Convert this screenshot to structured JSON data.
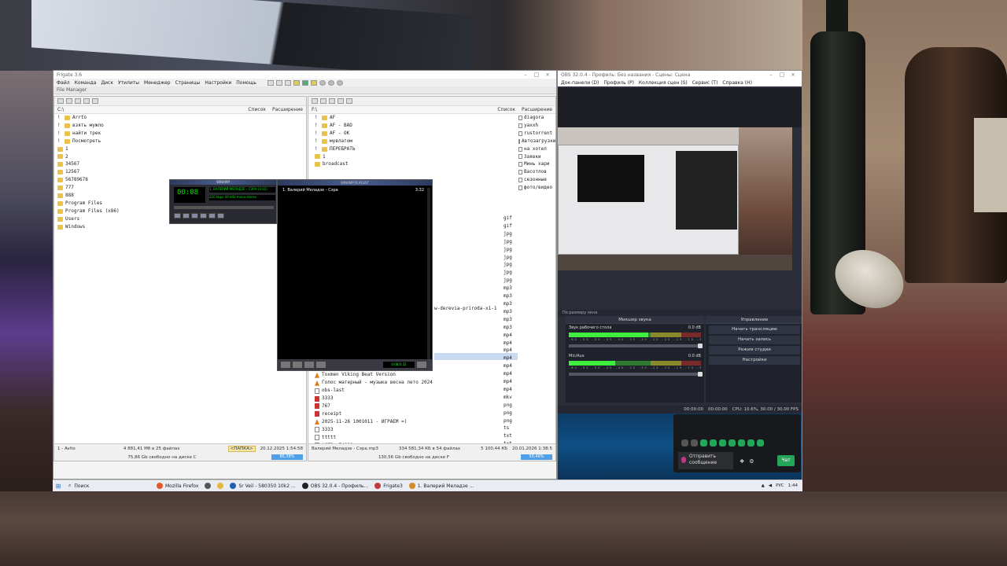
{
  "file_manager": {
    "title": "Frigate 3.6",
    "subtitle": "File Manager",
    "menu": [
      "Файл",
      "Команда",
      "Диск",
      "Утилиты",
      "Менеджер",
      "Страницы",
      "Настройки",
      "Помощь"
    ],
    "left": {
      "path": "C:\\",
      "col_list": "Список",
      "col_ext": "Расширение",
      "items": [
        {
          "name": "Arrto",
          "type": "folder",
          "indent": 1
        },
        {
          "name": "взять мужло",
          "type": "folder",
          "indent": 1
        },
        {
          "name": "найти трек",
          "type": "folder",
          "indent": 1
        },
        {
          "name": "Посмотреть",
          "type": "folder",
          "indent": 1
        },
        {
          "name": "1",
          "type": "folder",
          "indent": 0
        },
        {
          "name": "2",
          "type": "folder",
          "indent": 0
        },
        {
          "name": "34567",
          "type": "folder",
          "indent": 0
        },
        {
          "name": "12567",
          "type": "folder",
          "indent": 0
        },
        {
          "name": "56789678",
          "type": "folder",
          "indent": 0
        },
        {
          "name": "777",
          "type": "folder",
          "indent": 0
        },
        {
          "name": "888",
          "type": "folder",
          "indent": 0
        },
        {
          "name": "Program Files",
          "type": "folder",
          "indent": 0
        },
        {
          "name": "Program Files (x86)",
          "type": "folder",
          "indent": 0
        },
        {
          "name": "Users",
          "type": "folder",
          "indent": 0
        },
        {
          "name": "Windows",
          "type": "folder",
          "indent": 0
        }
      ],
      "status_left": "1 - Avito",
      "status_mid": "4 881,41 Мб в 25 файлах",
      "status_tag": "<ПАПКА>",
      "status_date": "20.12.2025 1:54:58",
      "free_text": "75,86 Gb свободно на диске C",
      "free_pct": "86,38%"
    },
    "right": {
      "path": "F:\\",
      "col_list": "Список",
      "col_ext": "Расширение",
      "items": [
        {
          "name": "AF",
          "type": "folder",
          "indent": 1
        },
        {
          "name": "AF - BAD",
          "type": "folder",
          "indent": 1
        },
        {
          "name": "AF - OK",
          "type": "folder",
          "indent": 1
        },
        {
          "name": "мувлатом",
          "type": "folder",
          "indent": 1
        },
        {
          "name": "ПЕРЕБРАТЬ",
          "type": "folder",
          "indent": 1
        },
        {
          "name": "1",
          "type": "folder",
          "indent": 0
        },
        {
          "name": "broadcast",
          "type": "folder",
          "indent": 0
        }
      ],
      "long_name": "w-derevia-priroda-x1-1",
      "files": [
        {
          "name": "Toxmen Viking Beat Version",
          "icon": "cone"
        },
        {
          "name": "Голос матерный - музыка весна лето 2024",
          "icon": "cone"
        },
        {
          "name": "obs-last",
          "icon": "txt"
        },
        {
          "name": "3333",
          "icon": "img"
        },
        {
          "name": "767",
          "icon": "img"
        },
        {
          "name": "receipt",
          "icon": "img"
        },
        {
          "name": "2025-11-26 1001011 - ИГРАЕМ =)",
          "icon": "cone"
        },
        {
          "name": "3333",
          "icon": "txt"
        },
        {
          "name": "ttttt",
          "icon": "txt"
        },
        {
          "name": "ACER s74820",
          "icon": "txt"
        }
      ],
      "extensions": [
        "gif",
        "gif",
        "jpg",
        "jpg",
        "jpg",
        "jpg",
        "jpg",
        "jpg",
        "jpg",
        "mp3",
        "mp3",
        "mp3",
        "mp3",
        "mp3",
        "mp3",
        "mp4",
        "mp4",
        "mp4",
        "mp4",
        "mp4",
        "mp4",
        "mp4",
        "mp4",
        "mkv",
        "png",
        "png",
        "png",
        "ts",
        "txt",
        "txt",
        "txt"
      ],
      "side_items": [
        "diagora",
        "yaxxh",
        "rustorrent",
        "Автозагрузки",
        "на хотел",
        "Заявки",
        "Минь хари",
        "Васотлов",
        "сезонные",
        "фото/видео"
      ],
      "status_left": "Валерий Меладзе - Сэра.mp3",
      "status_mid": "334 581,34 КБ в 54 файлах",
      "status_size": "5 100,44 КБ",
      "status_date": "20.01.2026 1:38:5",
      "free_text": "130,56 Gb свободно на диске F",
      "free_pct": "50,46%"
    }
  },
  "winamp": {
    "title": "WINAMP",
    "time": "00:08",
    "info": "1. ВАЛЕРИЙ МЕЛАДЗЕ - СЭРА (3:32)",
    "kbps": "320 kbps  44 kHz  mono stereo"
  },
  "playlist": {
    "title": "WINAMP PLAYLIST",
    "track": "1. Валерий Меладзе - Сэра",
    "duration": "3:32",
    "mini_time": "0:08/3:32"
  },
  "obs": {
    "title": "OBS 32.0.4 - Профиль: Без названия - Сцены: Сцена",
    "menu": [
      "Док-панели (D)",
      "Профиль (P)",
      "Коллекция сцен (S)",
      "Сервис (T)",
      "Справка (H)"
    ],
    "scene_label": "По размеру окна",
    "mixer": {
      "title": "Микшер звука",
      "channels": [
        {
          "name": "Звук рабочего стола",
          "db": "0.0 dB",
          "level": 0.6
        },
        {
          "name": "Mic/Aux",
          "db": "0.0 dB",
          "level": 0.35
        }
      ],
      "ticks": "-60 -55 -50 -45 -40 -35 -30 -25 -20 -15 -10 -5 0"
    },
    "controls": {
      "title": "Управление",
      "buttons": [
        "Начать трансляцию",
        "Начать запись",
        "Режим студии",
        "Настройки"
      ]
    },
    "status": {
      "rec": "00:00:00",
      "stream": "00:00:00",
      "cpu": "CPU: 10.6%, 30.00 / 30.00 FPS"
    }
  },
  "discord": {
    "send_label": "Отправить сообщение",
    "chat_label": "Чат"
  },
  "taskbar": {
    "search": "Поиск",
    "apps": [
      {
        "label": "Mozilla Firefox",
        "color": "#e5572b"
      },
      {
        "label": "",
        "color": "#555555"
      },
      {
        "label": "",
        "color": "#e6b83a"
      },
      {
        "label": "Sr Veil - 580350 10k2 ...",
        "color": "#1d5fb3"
      },
      {
        "label": "OBS 32.0.4 - Профиль...",
        "color": "#222222"
      },
      {
        "label": "Frigate3",
        "color": "#c43b3b"
      },
      {
        "label": "1. Валерий Меладзе ...",
        "color": "#d48a2a"
      }
    ],
    "lang": "РУС",
    "clock": "1:44"
  }
}
